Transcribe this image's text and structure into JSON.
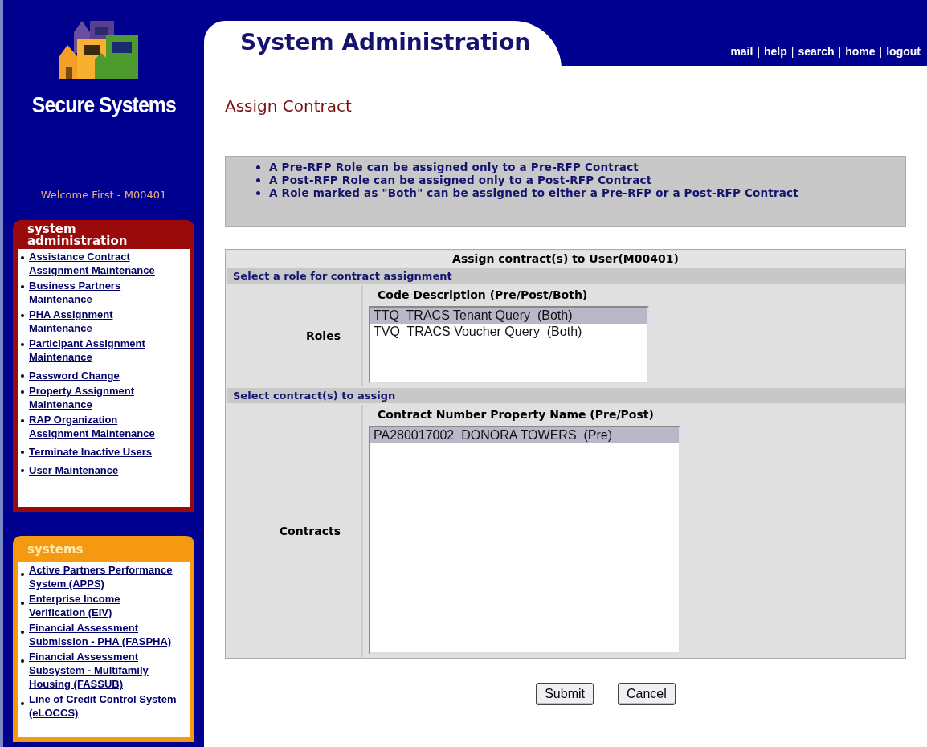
{
  "brand": {
    "name": "Secure Systems"
  },
  "welcome": "Welcome First - M00401",
  "sidebar": {
    "panels": [
      {
        "kind": "admin",
        "title": "system administration",
        "items": [
          "Assistance Contract Assignment Maintenance",
          "Business Partners Maintenance",
          "PHA Assignment Maintenance",
          "Participant Assignment Maintenance",
          "Password Change",
          "Property Assignment Maintenance",
          "RAP Organization Assignment Maintenance",
          "Terminate Inactive Users",
          "User Maintenance"
        ]
      },
      {
        "kind": "systems",
        "title": "systems",
        "items": [
          "Active Partners Performance System (APPS)",
          "Enterprise Income Verification (EIV)",
          "Financial Assessment Submission - PHA (FASPHA)",
          "Financial Assessment Subsystem - Multifamily Housing (FASSUB)",
          "Line of Credit Control System (eLOCCS)"
        ]
      }
    ]
  },
  "header": {
    "title": "System Administration",
    "links": [
      "mail",
      "help",
      "search",
      "home",
      "logout"
    ],
    "separator": "|"
  },
  "page_title": "Assign Contract",
  "notes": [
    "A Pre-RFP Role can be assigned only to a Pre-RFP Contract",
    "A Post-RFP Role can be assigned only to a Post-RFP Contract",
    "A Role marked as \"Both\" can be assigned to either a Pre-RFP or a Post-RFP Contract"
  ],
  "form": {
    "title": "Assign contract(s) to User(M00401)",
    "sections": [
      {
        "heading": "Select a role for contract assignment",
        "label": "Roles",
        "list_heading": "Code Description (Pre/Post/Both)",
        "kind": "roles",
        "options": [
          {
            "text": "TTQ  TRACS Tenant Query  (Both)",
            "selected": true
          },
          {
            "text": "TVQ  TRACS Voucher Query  (Both)",
            "selected": false
          }
        ]
      },
      {
        "heading": "Select contract(s) to assign",
        "label": "Contracts",
        "list_heading": "Contract Number Property Name  (Pre/Post)",
        "kind": "contracts",
        "options": [
          {
            "text": "PA280017002  DONORA TOWERS  (Pre)",
            "selected": true
          }
        ]
      }
    ]
  },
  "buttons": [
    "Submit",
    "Cancel"
  ]
}
